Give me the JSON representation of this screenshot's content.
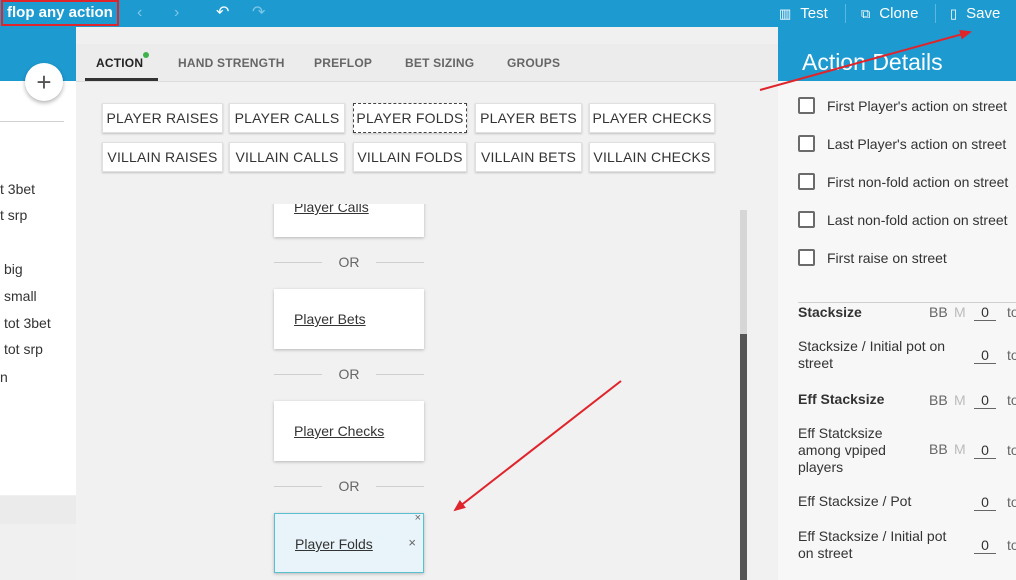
{
  "topbar": {
    "title": "flop any action",
    "back_icon": "chevron-left-icon",
    "forward_icon": "chevron-right-icon",
    "undo_icon": "undo-icon",
    "redo_icon": "redo-icon",
    "test_label": "Test",
    "clone_label": "Clone",
    "save_label": "Save"
  },
  "left": {
    "items": [
      "t 3bet",
      "t srp",
      "big",
      "small",
      "tot 3bet",
      "tot srp",
      "n"
    ]
  },
  "tabs": [
    {
      "label": "ACTION"
    },
    {
      "label": "HAND STRENGTH"
    },
    {
      "label": "PREFLOP"
    },
    {
      "label": "BET SIZING"
    },
    {
      "label": "GROUPS"
    }
  ],
  "chips": {
    "player": [
      "PLAYER RAISES",
      "PLAYER CALLS",
      "PLAYER FOLDS",
      "PLAYER BETS",
      "PLAYER CHECKS"
    ],
    "villain": [
      "VILLAIN RAISES",
      "VILLAIN CALLS",
      "VILLAIN FOLDS",
      "VILLAIN BETS",
      "VILLAIN CHECKS"
    ]
  },
  "flow": {
    "nodes": [
      "Player Calls",
      "Player Bets",
      "Player Checks",
      "Player Folds"
    ],
    "or_label": "OR",
    "close_glyph": "×"
  },
  "right": {
    "title": "Action Details",
    "checkboxes": [
      "First Player's action on street",
      "Last Player's action on street",
      "First non-fold action on street",
      "Last non-fold action on street",
      "First raise on street"
    ],
    "unit_bb": "BB",
    "unit_m": "M",
    "to_label": "to",
    "stack_rows": [
      {
        "label": "Stacksize",
        "bold": true,
        "units": true,
        "value": "0"
      },
      {
        "label": "Stacksize / Initial pot on street",
        "bold": false,
        "units": false,
        "value": "0"
      },
      {
        "label": "Eff Stacksize",
        "bold": true,
        "units": true,
        "value": "0"
      },
      {
        "label": "Eff Statcksize among vpiped players",
        "bold": false,
        "units": true,
        "value": "0"
      },
      {
        "label": "Eff Stacksize / Pot",
        "bold": false,
        "units": false,
        "value": "0"
      },
      {
        "label": "Eff Stacksize / Initial pot on street",
        "bold": false,
        "units": false,
        "value": "0"
      }
    ]
  },
  "colors": {
    "primary": "#1d9bd1",
    "highlight_box": "#e0242b",
    "arrow": "#e0242b",
    "active_dot": "#3cb44a"
  }
}
